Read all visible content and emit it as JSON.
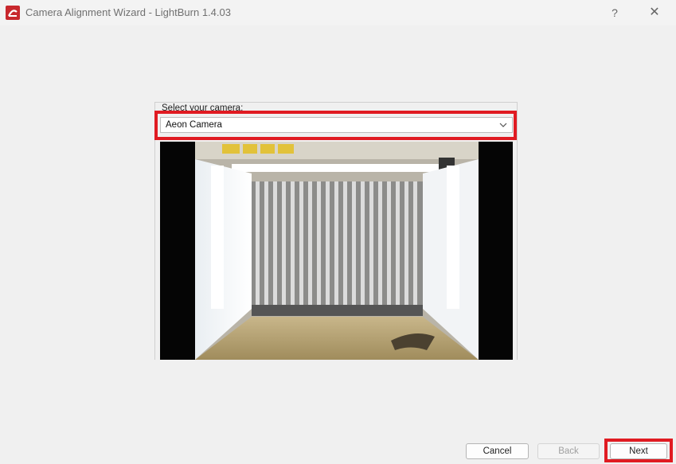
{
  "window": {
    "title": "Camera Alignment Wizard - LightBurn 1.4.03",
    "help_label": "?",
    "close_label": "✕"
  },
  "camera_select": {
    "label": "Select your camera:",
    "selected": "Aeon Camera"
  },
  "camera_preview": {
    "icon": "camera-feed-image",
    "description_visible": false
  },
  "footer": {
    "cancel_label": "Cancel",
    "back_label": "Back",
    "next_label": "Next"
  },
  "colors": {
    "highlight": "#e01b22",
    "brand": "#c8282d"
  }
}
